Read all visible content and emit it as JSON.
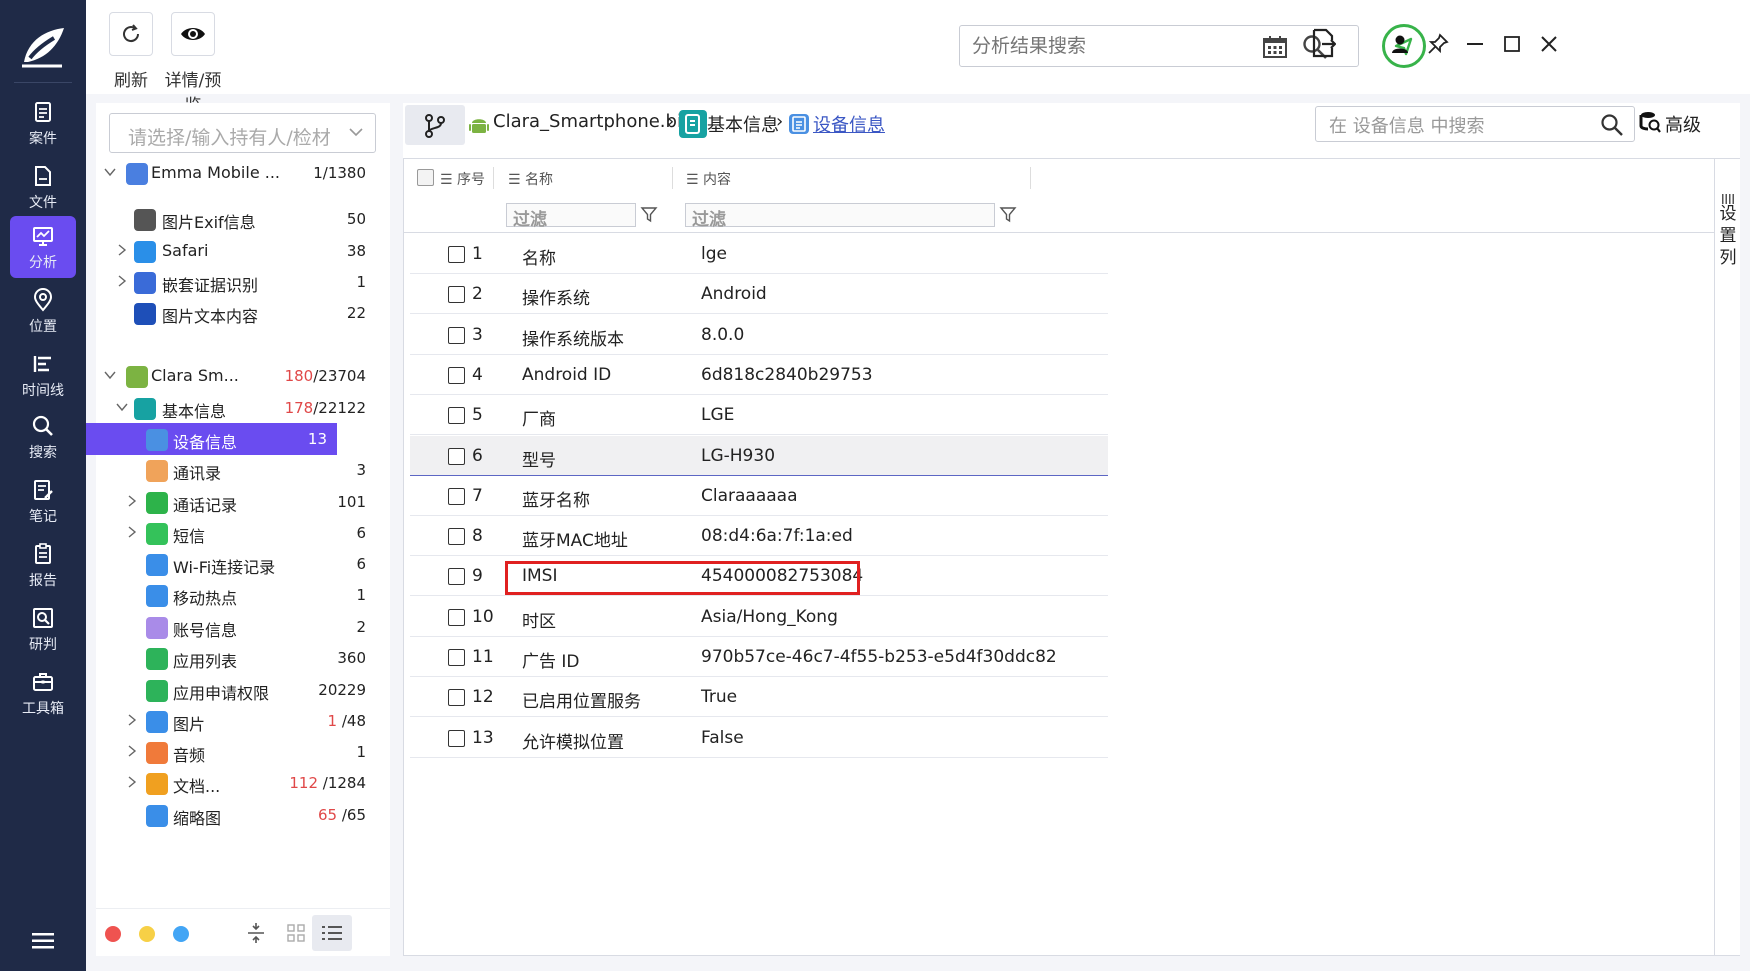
{
  "nav": {
    "items": [
      {
        "label": "案件",
        "icon": "case-icon"
      },
      {
        "label": "文件",
        "icon": "file-icon"
      },
      {
        "label": "分析",
        "icon": "analysis-icon",
        "active": true
      },
      {
        "label": "位置",
        "icon": "location-icon"
      },
      {
        "label": "时间线",
        "icon": "timeline-icon"
      },
      {
        "label": "搜索",
        "icon": "search-icon"
      },
      {
        "label": "笔记",
        "icon": "note-icon"
      },
      {
        "label": "报告",
        "icon": "report-icon"
      },
      {
        "label": "研判",
        "icon": "judge-icon"
      },
      {
        "label": "工具箱",
        "icon": "toolbox-icon"
      }
    ]
  },
  "toolbar": {
    "refresh_label": "刷新",
    "preview_label": "详情/预览",
    "search_placeholder": "分析结果搜索"
  },
  "tree": {
    "owner_placeholder": "请选择/输入持有人/检材",
    "rows": [
      {
        "label": "Emma Mobile ...",
        "count_red": "",
        "count": "1/1380",
        "level": 0,
        "arrow": "down",
        "icon": "phone-icon",
        "color": "#4a7fe0"
      },
      {
        "label": "图片Exif信息",
        "count_red": "",
        "count": "50",
        "level": 1,
        "arrow": "",
        "icon": "image-icon",
        "color": "#555555"
      },
      {
        "label": "Safari",
        "count_red": "",
        "count": "38",
        "level": 1,
        "arrow": "right",
        "icon": "safari-icon",
        "color": "#2a8fe8"
      },
      {
        "label": "嵌套证据识别",
        "count_red": "",
        "count": "1",
        "level": 1,
        "arrow": "right",
        "icon": "monitor-icon",
        "color": "#3a6bd8"
      },
      {
        "label": "图片文本内容",
        "count_red": "",
        "count": "22",
        "level": 1,
        "arrow": "",
        "icon": "ocr-icon",
        "color": "#1e4fb8"
      },
      {
        "label": "Clara Sm...",
        "count_red": "180",
        "count": "/23704",
        "level": 0,
        "arrow": "down",
        "icon": "android-icon",
        "color": "#7cb342"
      },
      {
        "label": "基本信息",
        "count_red": "178",
        "count": "/22122",
        "level": 1,
        "arrow": "down",
        "icon": "info-icon",
        "color": "#17a2a2"
      },
      {
        "label": "设备信息",
        "count_red": "",
        "count": "13",
        "level": 2,
        "arrow": "",
        "icon": "device-info-icon",
        "color": "#4a90e2",
        "selected": true
      },
      {
        "label": "通讯录",
        "count_red": "",
        "count": "3",
        "level": 2,
        "arrow": "",
        "icon": "contacts-icon",
        "color": "#f0a35a"
      },
      {
        "label": "通话记录",
        "count_red": "",
        "count": "101",
        "level": 2,
        "arrow": "right",
        "icon": "phone-call-icon",
        "color": "#2db34a"
      },
      {
        "label": "短信",
        "count_red": "",
        "count": "6",
        "level": 2,
        "arrow": "right",
        "icon": "sms-icon",
        "color": "#34c25a"
      },
      {
        "label": "Wi-Fi连接记录",
        "count_red": "",
        "count": "6",
        "level": 2,
        "arrow": "",
        "icon": "wifi-icon",
        "color": "#3a8ee8"
      },
      {
        "label": "移动热点",
        "count_red": "",
        "count": "1",
        "level": 2,
        "arrow": "",
        "icon": "hotspot-icon",
        "color": "#3a8ee8"
      },
      {
        "label": "账号信息",
        "count_red": "",
        "count": "2",
        "level": 2,
        "arrow": "",
        "icon": "account-icon",
        "color": "#a98be8"
      },
      {
        "label": "应用列表",
        "count_red": "",
        "count": "360",
        "level": 2,
        "arrow": "",
        "icon": "app-list-icon",
        "color": "#2db35a"
      },
      {
        "label": "应用申请权限",
        "count_red": "",
        "count": "20229",
        "level": 2,
        "arrow": "",
        "icon": "permission-icon",
        "color": "#2db35a"
      },
      {
        "label": "图片",
        "count_red": "1",
        "count": " /48",
        "level": 2,
        "arrow": "right",
        "icon": "picture-icon",
        "color": "#3a8ee8"
      },
      {
        "label": "音频",
        "count_red": "",
        "count": "1",
        "level": 2,
        "arrow": "right",
        "icon": "audio-icon",
        "color": "#f07a3a"
      },
      {
        "label": "文档...",
        "count_red": "112",
        "count": " /1284",
        "level": 2,
        "arrow": "right",
        "icon": "document-icon",
        "color": "#f0a020"
      },
      {
        "label": "缩略图",
        "count_red": "65",
        "count": " /65",
        "level": 2,
        "arrow": "",
        "icon": "thumbnail-icon",
        "color": "#3a8ee8"
      }
    ]
  },
  "breadcrumb": {
    "file": "Clara_Smartphone.bin",
    "section": "基本信息",
    "current": "设备信息"
  },
  "main_search_placeholder": "在 设备信息 中搜索",
  "advanced_label": "高级",
  "table": {
    "headers": {
      "index": "序号",
      "name": "名称",
      "content": "内容"
    },
    "filter_placeholder": "过滤",
    "rows": [
      {
        "n": "1",
        "name": "名称",
        "value": "lge"
      },
      {
        "n": "2",
        "name": "操作系统",
        "value": "Android"
      },
      {
        "n": "3",
        "name": "操作系统版本",
        "value": "8.0.0"
      },
      {
        "n": "4",
        "name": "Android ID",
        "value": "6d818c2840b29753"
      },
      {
        "n": "5",
        "name": "厂商",
        "value": "LGE"
      },
      {
        "n": "6",
        "name": "型号",
        "value": "LG-H930"
      },
      {
        "n": "7",
        "name": "蓝牙名称",
        "value": "Claraaaaaa"
      },
      {
        "n": "8",
        "name": "蓝牙MAC地址",
        "value": "08:d4:6a:7f:1a:ed"
      },
      {
        "n": "9",
        "name": "IMSI",
        "value": "454000082753084"
      },
      {
        "n": "10",
        "name": "时区",
        "value": "Asia/Hong_Kong"
      },
      {
        "n": "11",
        "name": "广告 ID",
        "value": "970b57ce-46c7-4f55-b253-e5d4f30ddc82"
      },
      {
        "n": "12",
        "name": "已启用位置服务",
        "value": "True"
      },
      {
        "n": "13",
        "name": "允许模拟位置",
        "value": "False"
      }
    ],
    "highlighted_row": 9
  },
  "column_settings_label": "设置列",
  "colors": {
    "nav_bg": "#1f2a47",
    "accent": "#6a4cf0",
    "highlight_border": "#e02020",
    "status_green": "#38b34a"
  }
}
